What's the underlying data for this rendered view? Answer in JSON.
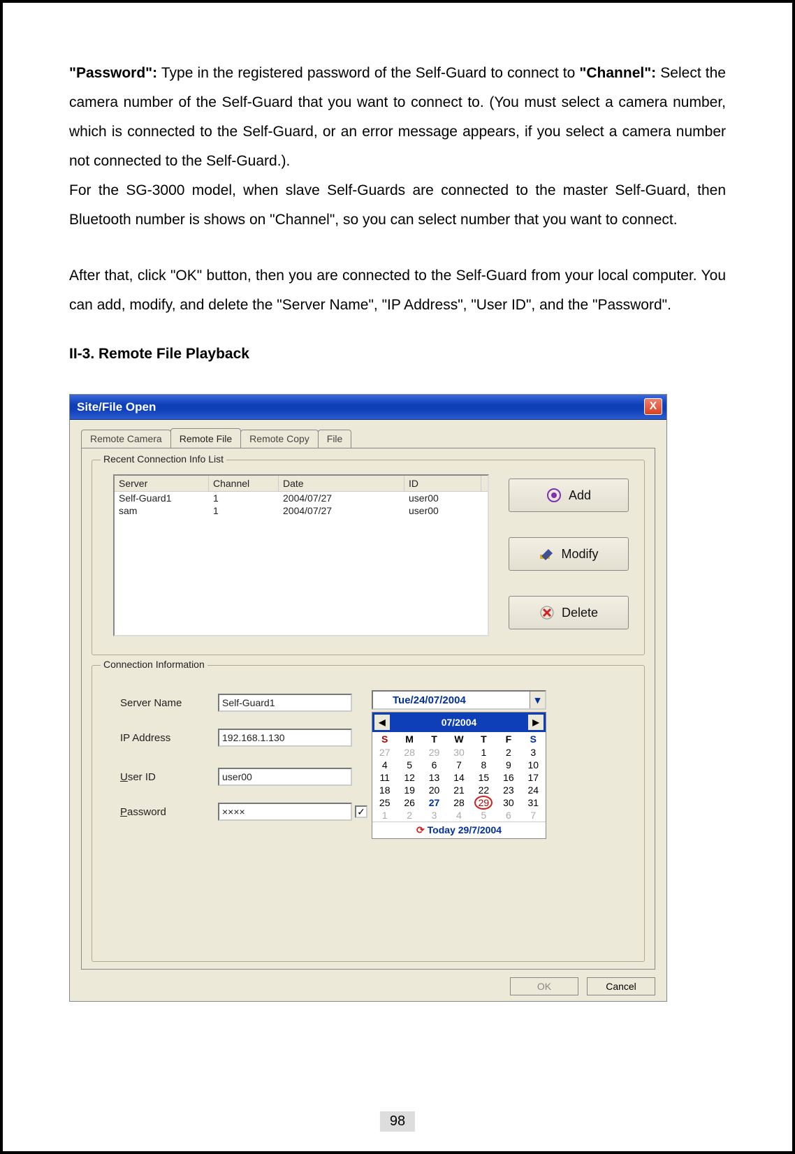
{
  "text": {
    "password_label": "\"Password\":",
    "password_text": " Type in the registered password of the Self-Guard to connect to ",
    "channel_label": "\"Channel\":",
    "channel_text": " Select the camera number of the Self-Guard that you want to connect to. (You must select a camera number, which is connected to the Self-Guard, or an error message appears, if you select a camera number not connected to the Self-Guard.).",
    "sg3000_text": "For the SG-3000 model, when slave Self-Guards are connected to the master Self-Guard, then Bluetooth number is shows on \"Channel\", so you can select number that you want to connect.",
    "after_text": "After that, click \"OK\" button, then you are connected to the Self-Guard from your local computer. You can add, modify, and delete the \"Server Name\", \"IP Address\", \"User ID\", and the \"Password\".",
    "section_title": "II-3. Remote File Playback"
  },
  "dialog": {
    "title": "Site/File Open",
    "close": "X",
    "tabs": [
      "Remote Camera",
      "Remote File",
      "Remote Copy",
      "File"
    ],
    "active_tab": 1,
    "group1_label": "Recent Connection Info List",
    "group2_label": "Connection Information",
    "list_headers": {
      "server": "Server",
      "channel": "Channel",
      "date": "Date",
      "id": "ID"
    },
    "list_rows": [
      {
        "server": "Self-Guard1",
        "channel": "1",
        "date": "2004/07/27",
        "id": "user00"
      },
      {
        "server": "sam",
        "channel": "1",
        "date": "2004/07/27",
        "id": "user00"
      }
    ],
    "buttons": {
      "add": "Add",
      "modify": "Modify",
      "delete": "Delete"
    },
    "form": {
      "server_name_label": "Server Name",
      "server_name_value": "Self-Guard1",
      "ip_label": "IP Address",
      "ip_value": "192.168.1.130",
      "user_id_label_pre": "U",
      "user_id_label_post": "ser ID",
      "user_id_value": "user00",
      "password_label_pre": "P",
      "password_label_post": "assword",
      "password_value": "××××",
      "checkbox_checked": "✓"
    },
    "datepicker_value": "Tue/24/07/2004",
    "calendar": {
      "month": "07/2004",
      "dow": [
        "S",
        "M",
        "T",
        "W",
        "T",
        "F",
        "S"
      ],
      "today_label": "Today 29/7/2004"
    },
    "bottom": {
      "ok": "OK",
      "cancel": "Cancel"
    }
  },
  "page_number": "98"
}
